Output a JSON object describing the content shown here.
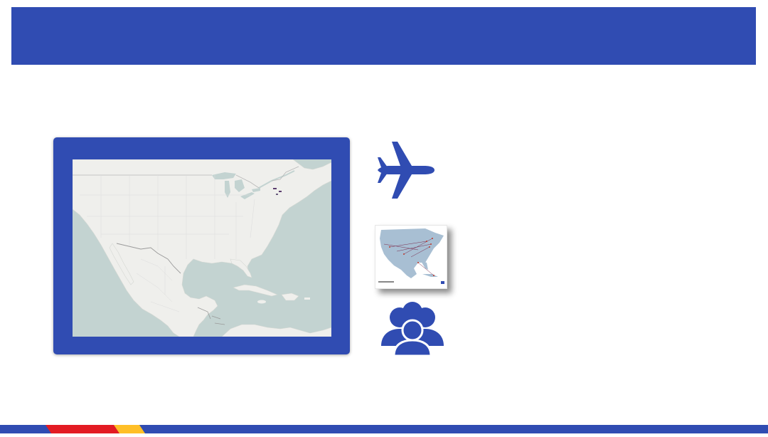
{
  "colors": {
    "brand_blue": "#304CB2",
    "brand_red": "#E31B23",
    "brand_yellow": "#FFBF27",
    "map_water": "#C3D3D1",
    "map_land": "#EFEFEC"
  },
  "icons": {
    "plane": "airplane-icon",
    "route_map": "route-map-thumbnail",
    "people": "people-group-icon"
  }
}
